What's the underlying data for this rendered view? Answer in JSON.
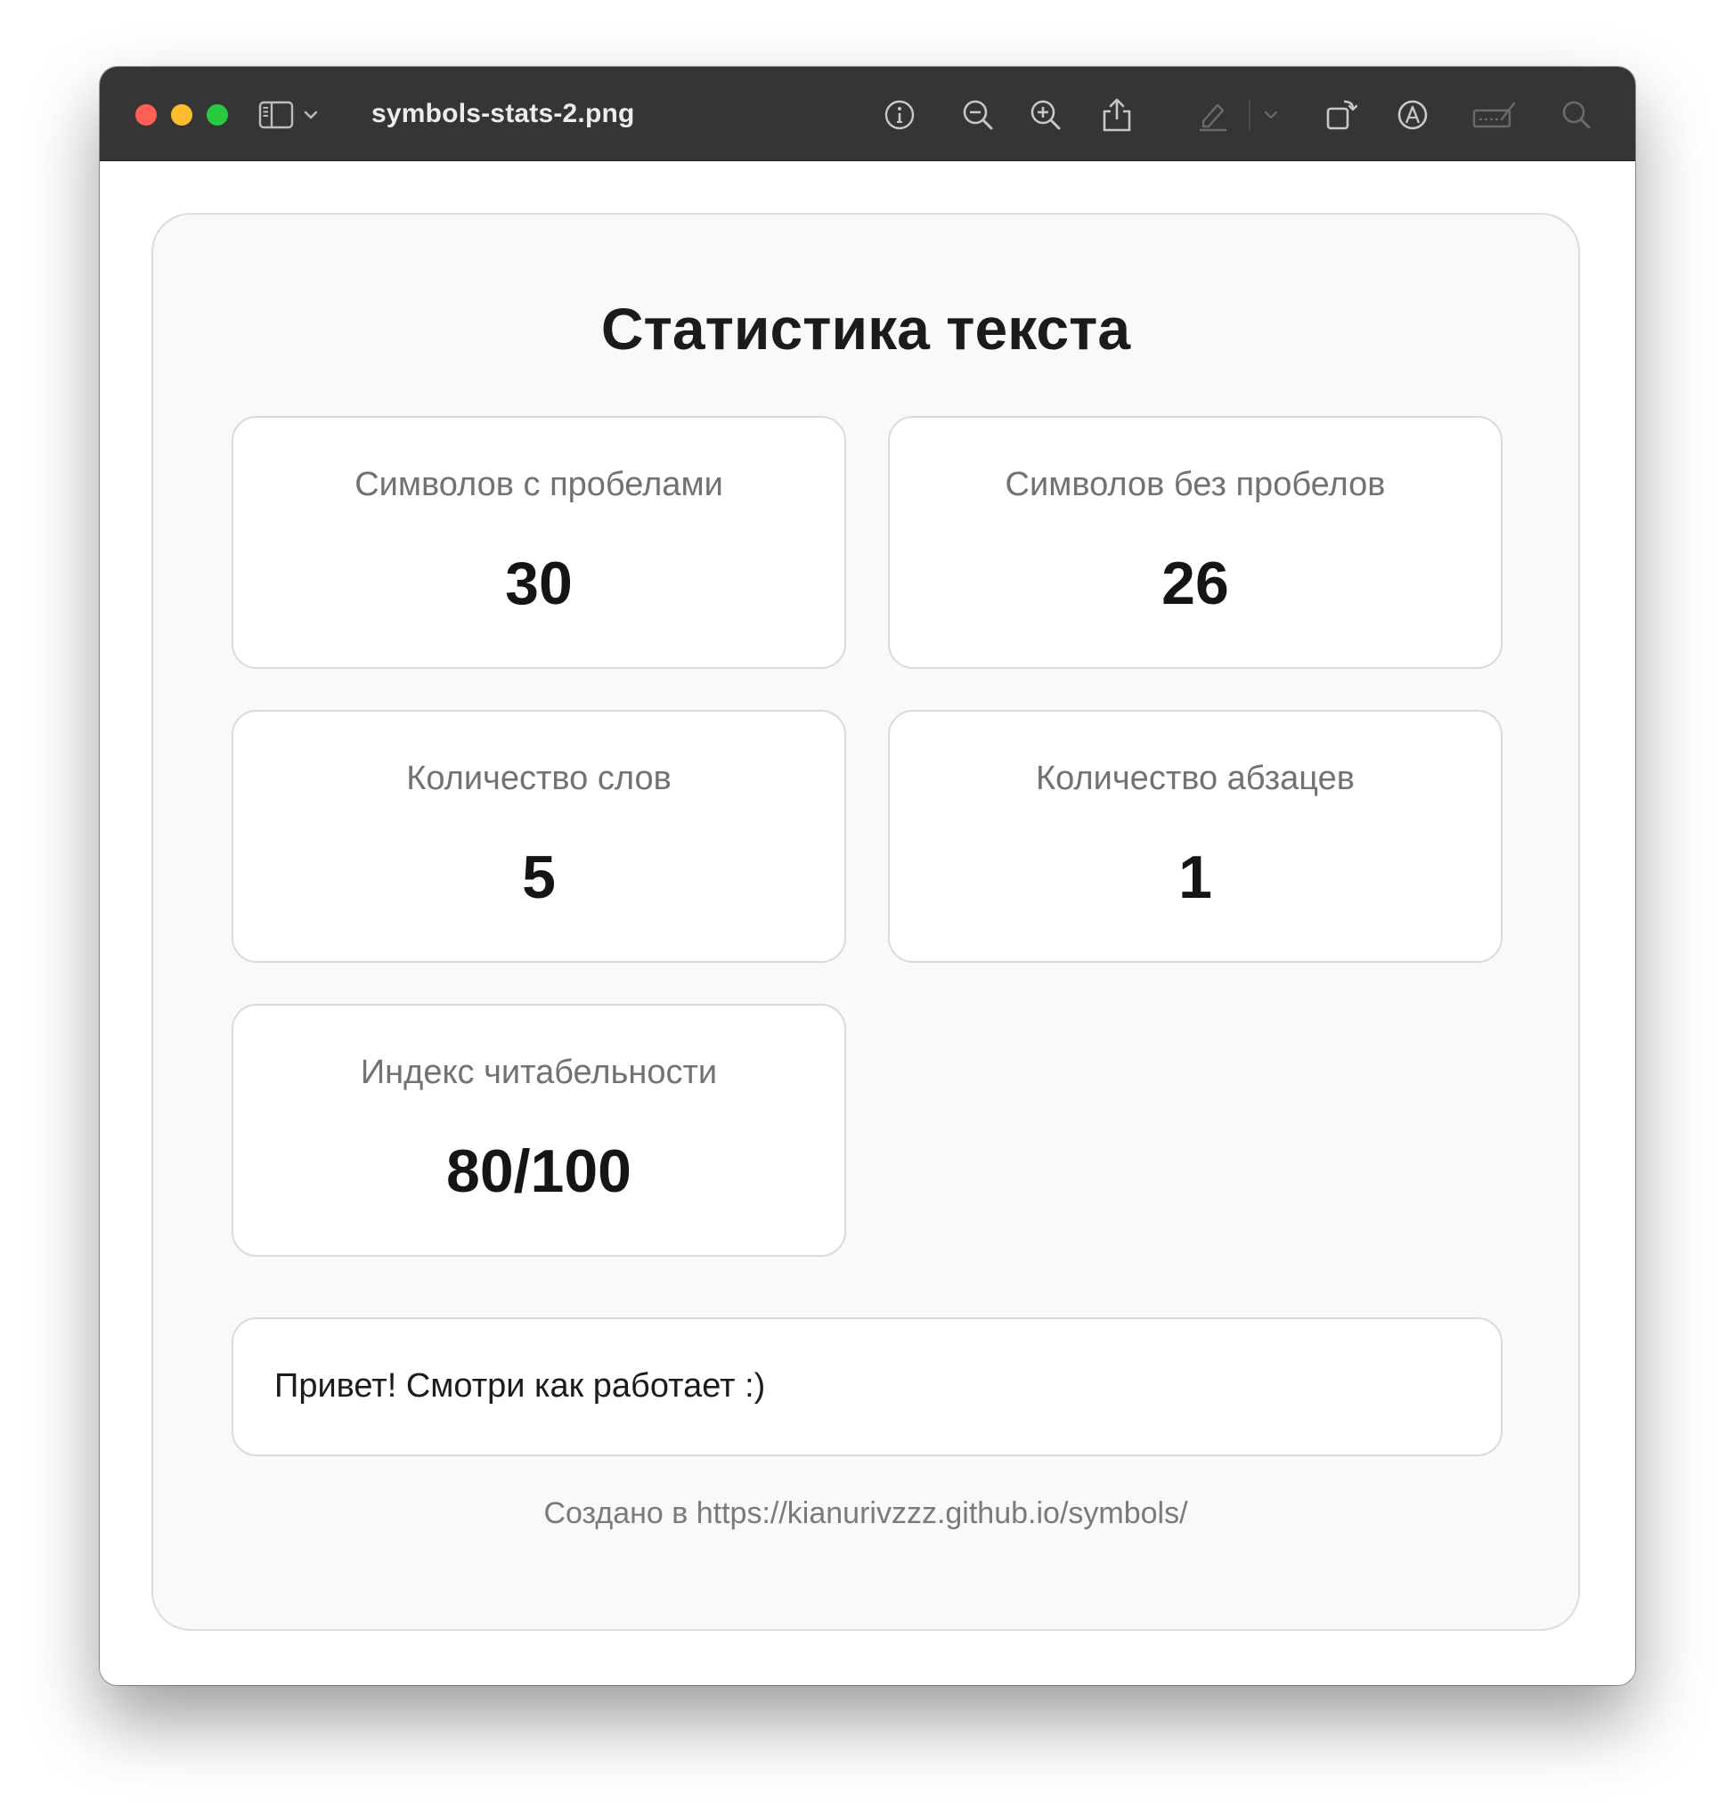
{
  "window": {
    "title": "symbols-stats-2.png"
  },
  "toolbar": {
    "icons": [
      "sidebar-icon",
      "chevron-down-icon",
      "info-icon",
      "zoom-out-icon",
      "zoom-in-icon",
      "share-icon",
      "highlight-pen-icon",
      "chevron-down-icon",
      "rotate-icon",
      "markup-icon",
      "sign-icon",
      "search-icon"
    ]
  },
  "page": {
    "title": "Статистика текста",
    "stats": [
      {
        "label": "Символов с пробелами",
        "value": "30"
      },
      {
        "label": "Символов без пробелов",
        "value": "26"
      },
      {
        "label": "Количество слов",
        "value": "5"
      },
      {
        "label": "Количество абзацев",
        "value": "1"
      },
      {
        "label": "Индекс читабельности",
        "value": "80/100"
      }
    ],
    "text": "Привет! Смотри как работает :)",
    "footer": "Создано в https://kianurivzzz.github.io/symbols/"
  },
  "colors": {
    "titlebar": "#353535",
    "traffic_red": "#ff5f57",
    "traffic_yellow": "#febc2e",
    "traffic_green": "#28c840",
    "card_background": "#f9f9fb"
  }
}
